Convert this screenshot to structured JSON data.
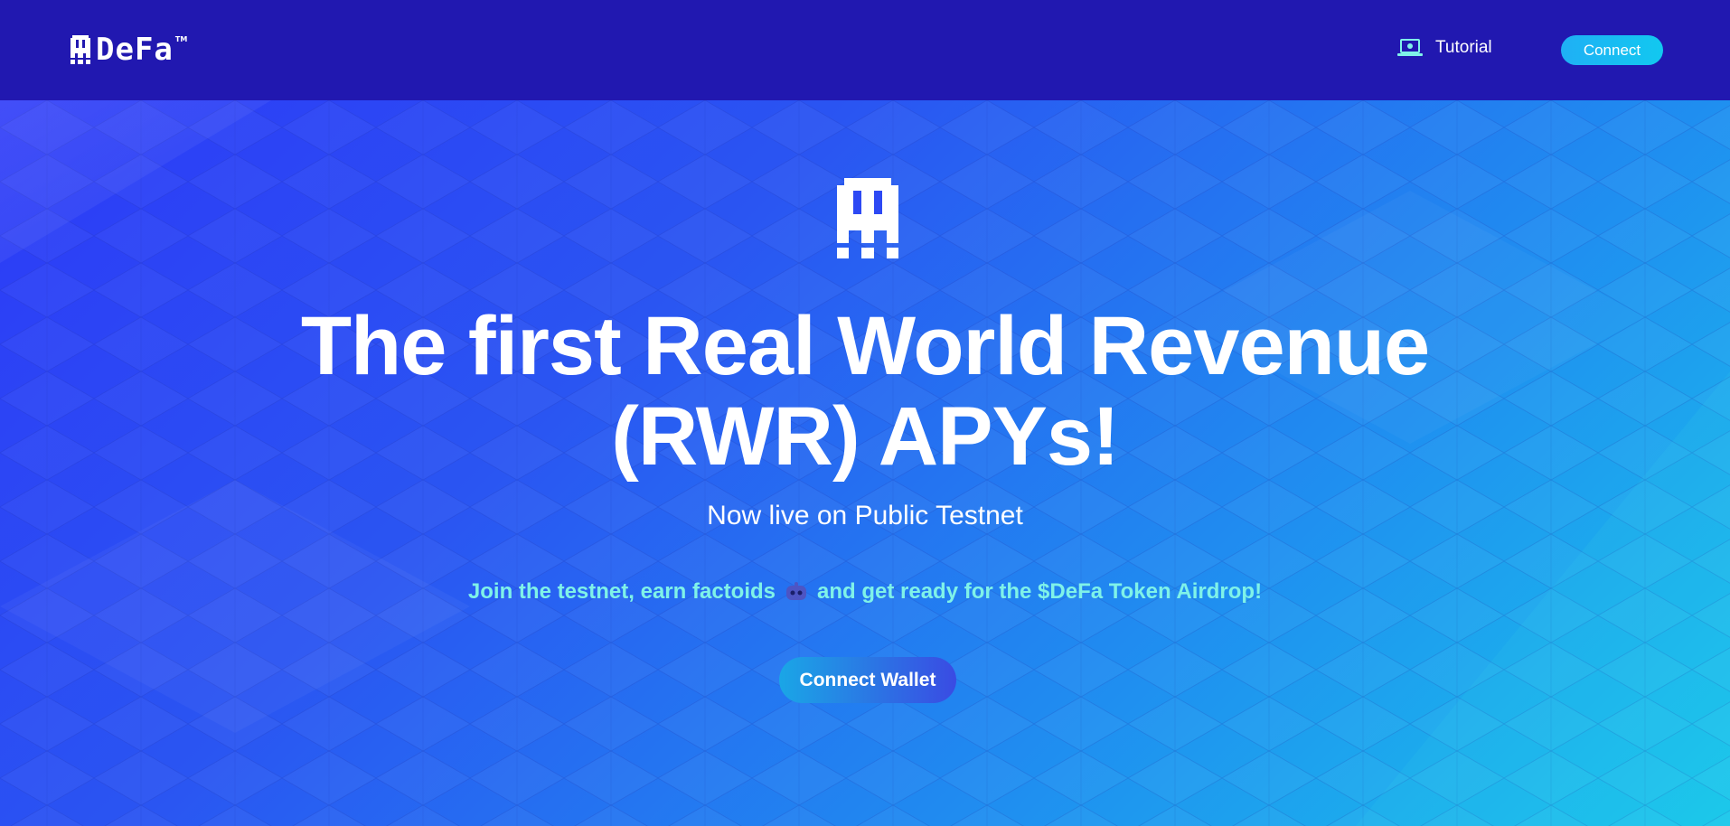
{
  "header": {
    "logo_text": "DeFa",
    "logo_tm": "TM",
    "tutorial_label": "Tutorial",
    "connect_label": "Connect"
  },
  "hero": {
    "headline_line1": "The first Real World Revenue",
    "headline_line2": "(RWR) APYs!",
    "subline": "Now live on Public Testnet",
    "join_part1": "Join the testnet, earn factoids",
    "join_part2": "and get ready for the $DeFa Token Airdrop!",
    "join_icon": "robot-emoji-icon",
    "wallet_button_label": "Connect Wallet"
  },
  "colors": {
    "header_bg": "#2118b0",
    "hero_gradient_start": "#2d3af7",
    "hero_gradient_end": "#19c6ea",
    "accent_text": "#7ff2e8",
    "connect_button": "#1fb0f5"
  },
  "icons": {
    "logo": "defa-mascot-icon",
    "tutorial": "laptop-icon",
    "hero": "defa-mascot-icon"
  }
}
